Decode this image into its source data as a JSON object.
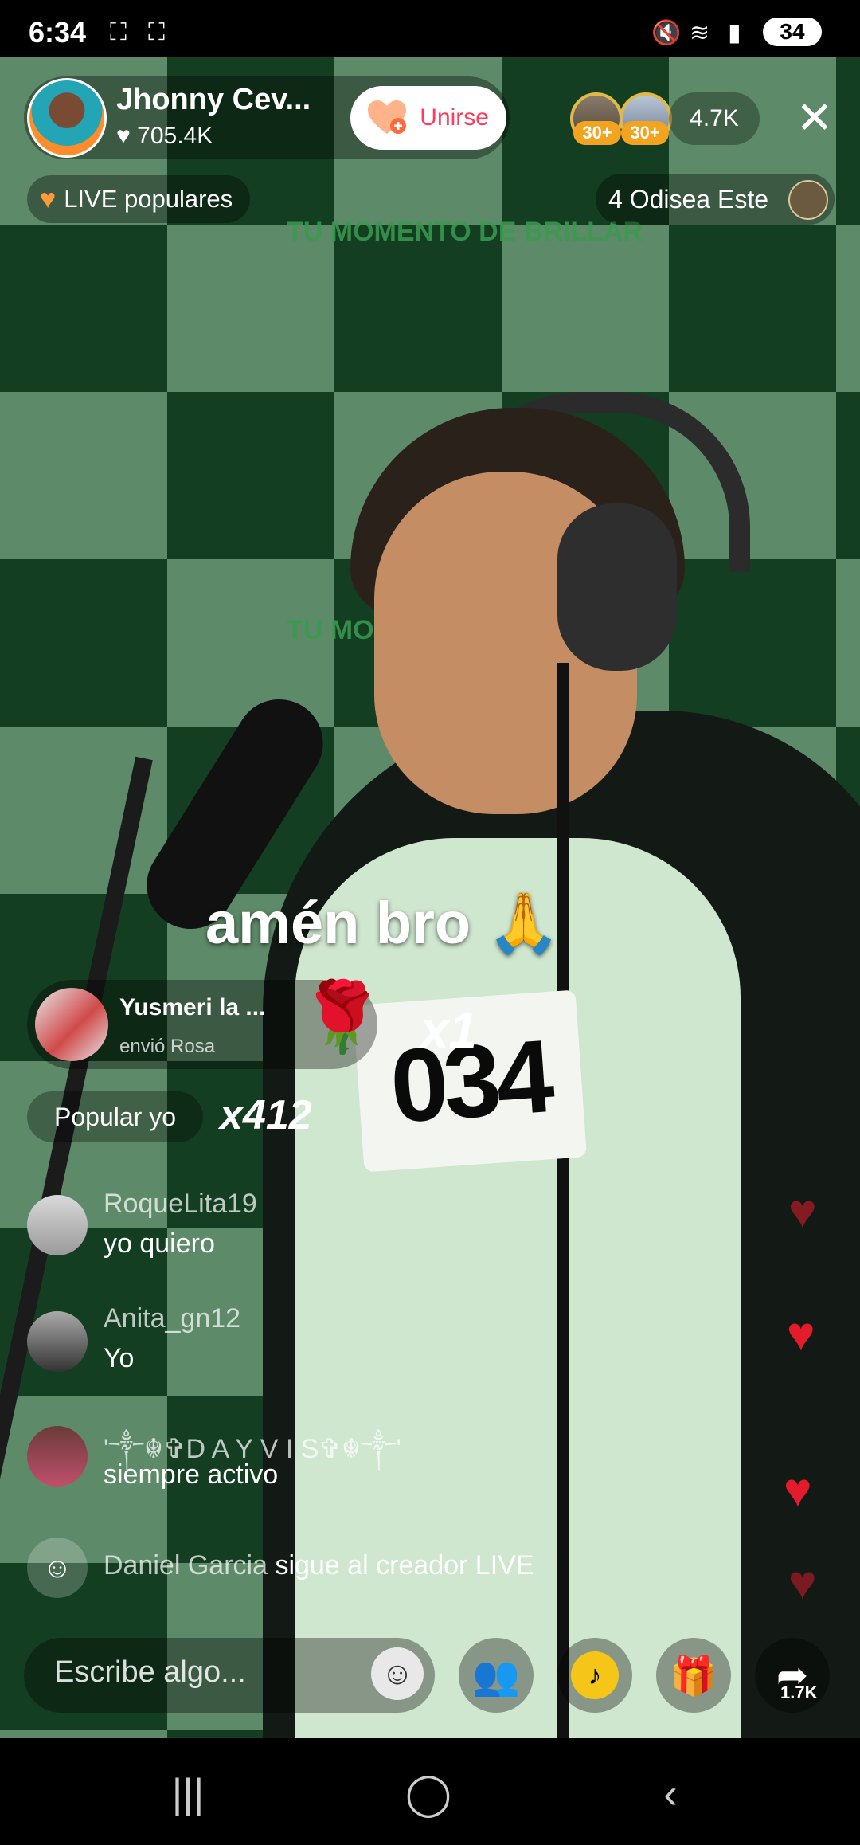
{
  "status_bar": {
    "time": "6:34",
    "battery": "34",
    "icons": [
      "screenshot-icon",
      "screen-record-icon",
      "mute-icon",
      "wifi-6-icon",
      "signal-icon",
      "battery-charging-icon"
    ]
  },
  "host": {
    "name": "Jhonny Cev...",
    "likes": "705.4K",
    "join_label": "Unirse"
  },
  "viewers": {
    "badges": [
      "30+",
      "30+"
    ],
    "count": "4.7K"
  },
  "tags": {
    "popular": "LIVE populares",
    "odisea": "4 Odisea Este"
  },
  "overlay_comment": "amén bro 🙏",
  "gift": {
    "user": "Yusmeri la ...",
    "subtitle": "envió Rosa",
    "count": "x1"
  },
  "combo": {
    "label": "Popular yo",
    "count": "x412"
  },
  "chat": [
    {
      "user": "RoqueLita19",
      "text": "yo quiero"
    },
    {
      "user": "Anita_gn12",
      "text": "Yo"
    },
    {
      "user": "'༒☬✞D A Y V I S✞☬༒'",
      "text": "siempre activo"
    }
  ],
  "follow_event": {
    "name": "Daniel Garcia",
    "text": "sigue al creador LIVE"
  },
  "bottom_bar": {
    "input_placeholder": "Escribe algo...",
    "share_count": "1.7K"
  },
  "background_text": {
    "banner_1": "TU MOMENTO DE BRILLAR",
    "number": "034"
  },
  "colors": {
    "accent": "#ff3b5c",
    "heart": "#e31b2b",
    "badge": "#f2a31f"
  }
}
